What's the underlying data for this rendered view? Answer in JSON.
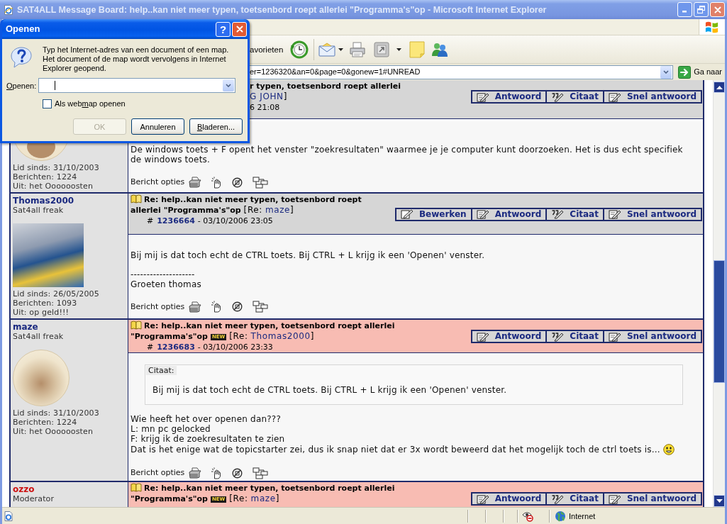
{
  "window": {
    "title": "SAT4ALL Message Board: help..kan niet meer typen, toetsenbord roept allerlei \"Programma's\"op - Microsoft Internet Explorer"
  },
  "dialog": {
    "title": "Openen",
    "help_button": "?",
    "message": "Typ het Internet-adres van een document of een map. Het document of de map wordt vervolgens in Internet Explorer geopend.",
    "field_label": {
      "key": "O",
      "after": "penen:"
    },
    "field_focused": true,
    "checkbox": {
      "label": {
        "before": "Als web",
        "key": "m",
        "after": "ap openen"
      },
      "checked": false
    },
    "buttons": [
      {
        "label": "OK",
        "disabled": true
      },
      {
        "label": "Annuleren",
        "disabled": false
      },
      {
        "label": {
          "key": "B",
          "after": "laderen..."
        },
        "disabled": false
      }
    ]
  },
  "toolbar": {
    "favorites_label": "avorieten"
  },
  "address_bar": {
    "url": "er=1236320&an=0&page=0&gonew=1#UNREAD",
    "go_button": "Ga naar"
  },
  "posts": [
    {
      "under_dialog": true,
      "unread": false,
      "user": {
        "avatar": {
          "kind": "round-bottom"
        },
        "stats": [
          "Lid sinds: 31/10/2003",
          "Berichten: 1224",
          "Uit: het Oooooosten"
        ]
      },
      "header": {
        "book_icon": false,
        "title": "r typen, toetsenbord roept allerlei",
        "reply_to": "G JOHN",
        "reply_close": "]",
        "date": "6 21:08"
      },
      "buttons": [
        {
          "kind": "reply",
          "label": "Antwoord"
        },
        {
          "kind": "quote",
          "label": "Citaat"
        },
        {
          "kind": "quick-reply",
          "label": "Snel antwoord"
        }
      ],
      "body": [
        {
          "kind": "text",
          "lines": [
            "De windows toets + F opent het venster \"zoekresultaten\" waarmee je je computer kunt doorzoeken. Het is dus echt specifiek de windows toets."
          ],
          "smiley": false
        }
      ],
      "options_label": "Bericht opties"
    },
    {
      "under_dialog": false,
      "unread": false,
      "user": {
        "name": "Thomas2000",
        "moderator": false,
        "rank": "Sat4all freak",
        "avatar": {
          "kind": "rect"
        },
        "stats": [
          "Lid sinds: 26/05/2005",
          "Berichten: 1093",
          "Uit: op geld!!!"
        ]
      },
      "header": {
        "book_icon": true,
        "title": "Re: help..kan niet meer typen, toetsenbord roept allerlei \"Programma's\"op",
        "reply_open": "[Re:",
        "reply_to": "maze",
        "reply_close": "]",
        "number_sign": "#",
        "post_number": "1236664",
        "date": "- 03/10/2006 23:05"
      },
      "buttons": [
        {
          "kind": "edit",
          "label": "Bewerken"
        },
        {
          "kind": "reply",
          "label": "Antwoord"
        },
        {
          "kind": "quote",
          "label": "Citaat"
        },
        {
          "kind": "quick-reply",
          "label": "Snel antwoord"
        }
      ],
      "body": [
        {
          "kind": "text",
          "lines": [
            "Bij mij is dat toch echt de CTRL toets. Bij CTRL + L krijg ik een 'Openen' venster."
          ],
          "smiley": false
        },
        {
          "kind": "text",
          "lines": [
            "--------------------",
            "Groeten thomas"
          ],
          "smiley": false
        }
      ],
      "options_label": "Bericht opties"
    },
    {
      "under_dialog": false,
      "unread": true,
      "user": {
        "name": "maze",
        "moderator": false,
        "rank": "Sat4all freak",
        "avatar": {
          "kind": "round"
        },
        "stats": [
          "Lid sinds: 31/10/2003",
          "Berichten: 1224",
          "Uit: het Oooooosten"
        ]
      },
      "header": {
        "book_icon": true,
        "title": "Re: help..kan niet meer typen, toetsenbord roept allerlei \"Programma's\"op",
        "badge": "NEW",
        "reply_open": "[Re:",
        "reply_to": "Thomas2000",
        "reply_close": "]",
        "number_sign": "#",
        "post_number": "1236683",
        "date": "- 03/10/2006 23:33"
      },
      "buttons": [
        {
          "kind": "reply",
          "label": "Antwoord"
        },
        {
          "kind": "quote",
          "label": "Citaat"
        },
        {
          "kind": "quick-reply",
          "label": "Snel antwoord"
        }
      ],
      "body": [
        {
          "kind": "quote",
          "label": "Citaat:",
          "text": "Bij mij is dat toch echt de CTRL toets. Bij CTRL + L krijg ik een 'Openen' venster."
        },
        {
          "kind": "text",
          "lines": [
            "Wie heeft het over openen dan???",
            "L: mn pc gelocked",
            "F: krijg ik de zoekresultaten te zien",
            "Dat is het enige wat de topicstarter zei, dus ik snap niet dat er 3x wordt beweerd dat het mogelijk toch de ctrl toets is..."
          ],
          "smiley": true
        }
      ],
      "options_label": "Bericht opties"
    },
    {
      "under_dialog": false,
      "unread": true,
      "user": {
        "name": "ozzo",
        "moderator": true,
        "rank": "Moderator"
      },
      "header": {
        "book_icon": true,
        "title": "Re: help..kan niet meer typen, toetsenbord roept allerlei \"Programma's\"op",
        "badge": "NEW",
        "reply_open": "[Re:",
        "reply_to": "maze",
        "reply_close": "]"
      },
      "buttons": [
        {
          "kind": "reply",
          "label": "Antwoord"
        },
        {
          "kind": "quote",
          "label": "Citaat"
        },
        {
          "kind": "quick-reply",
          "label": "Snel antwoord"
        }
      ]
    }
  ],
  "status_bar": {
    "zone": "Internet"
  }
}
